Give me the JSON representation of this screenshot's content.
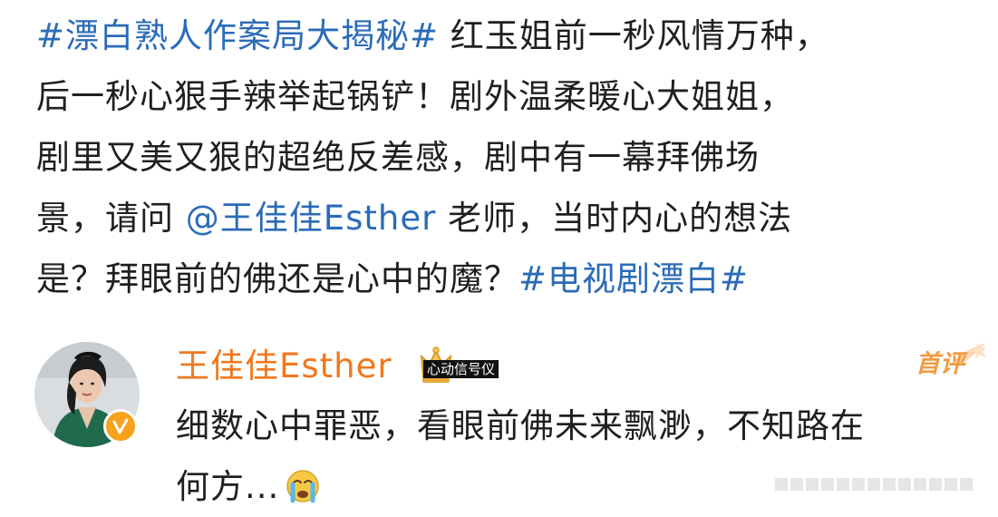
{
  "post": {
    "lines": [
      {
        "tag": "#漂白熟人作案局大揭秘#",
        "text": " 红玉姐前一秒风情万种，"
      },
      {
        "text": "后一秒心狠手辣举起锅铲！剧外温柔暖心大姐姐，"
      },
      {
        "text": "剧里又美又狠的超绝反差感，剧中有一幕拜佛场"
      },
      {
        "before": "景，请问 ",
        "mention": "@王佳佳Esther",
        "after": " 老师，当时内心的想法"
      },
      {
        "text": "是？拜眼前的佛还是心中的魔？",
        "tag": "#电视剧漂白#"
      }
    ]
  },
  "comment": {
    "author": "王佳佳Esther",
    "medal": "心动信号仪",
    "badge": "首评",
    "lines": [
      "细数心中罪恶，看眼前佛未来飘渺，不知路在",
      "何方..."
    ],
    "emoji": "crying-face-emoji"
  },
  "colors": {
    "link": "#2b6bb8",
    "author": "#f0781e",
    "badge": "#f39a42",
    "verified": "#f7a21b",
    "text": "#1f1f1f"
  }
}
